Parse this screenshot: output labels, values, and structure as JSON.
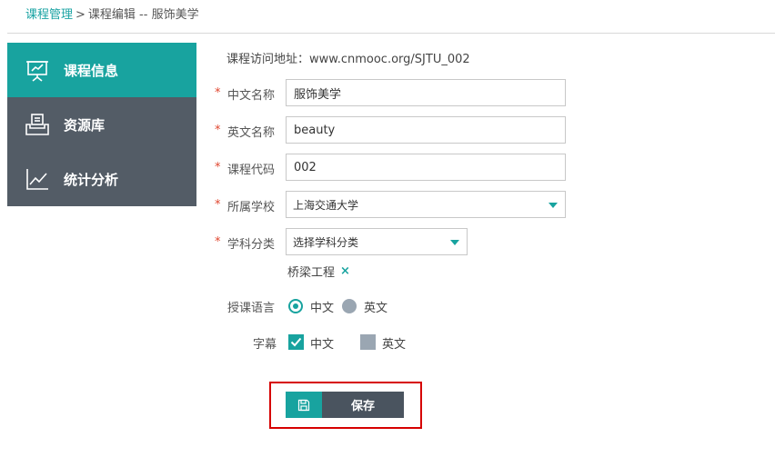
{
  "breadcrumb": {
    "parent": "课程管理",
    "separator": ">",
    "current": "课程编辑 -- 服饰美学"
  },
  "sidebar": {
    "items": [
      {
        "label": "课程信息",
        "icon": "presentation-board-icon",
        "active": true
      },
      {
        "label": "资源库",
        "icon": "inbox-tray-icon",
        "active": false
      },
      {
        "label": "统计分析",
        "icon": "line-chart-icon",
        "active": false
      }
    ]
  },
  "form": {
    "url_label": "课程访问地址：",
    "url_value": "www.cnmooc.org/SJTU_002",
    "required_mark": "*",
    "cn_name": {
      "label": "中文名称",
      "value": "服饰美学"
    },
    "en_name": {
      "label": "英文名称",
      "value": "beauty"
    },
    "course_code": {
      "label": "课程代码",
      "value": "002"
    },
    "school": {
      "label": "所属学校",
      "value": "上海交通大学"
    },
    "subject": {
      "label": "学科分类",
      "placeholder": "选择学科分类"
    },
    "subject_tag": {
      "label": "桥梁工程",
      "remove": "×"
    },
    "language": {
      "label": "授课语言",
      "options": [
        {
          "label": "中文",
          "selected": true
        },
        {
          "label": "英文",
          "selected": false
        }
      ]
    },
    "subtitles": {
      "label": "字幕",
      "options": [
        {
          "label": "中文",
          "checked": true
        },
        {
          "label": "英文",
          "checked": false
        }
      ]
    }
  },
  "actions": {
    "save_label": "保存"
  },
  "colors": {
    "accent": "#18a39f",
    "sidebar_bg": "#535c66",
    "required": "#e0462f",
    "highlight": "#d60000"
  }
}
